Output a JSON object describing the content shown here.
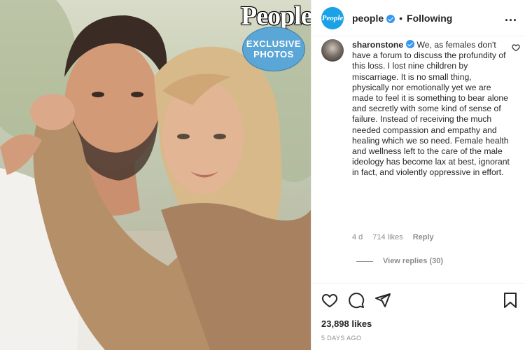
{
  "photo": {
    "badge_brand": "People",
    "badge_line1": "EXCLUSIVE",
    "badge_line2": "PHOTOS"
  },
  "header": {
    "avatar_text": "People",
    "username": "people",
    "separator": "•",
    "follow_status": "Following",
    "more_label": "..."
  },
  "comment": {
    "username": "sharonstone",
    "text": " We, as females don't have a forum to discuss the profundity of this loss. I lost nine children by miscarriage. It is no small thing, physically nor emotionally yet we are made to feel it is something to bear alone and secretly with some kind of sense of failure. Instead of receiving the much needed compassion and empathy and healing which we so need. Female health and wellness left to the care of the male ideology has become lax at best, ignorant in fact, and violently oppressive in effort.",
    "age": "4 d",
    "likes": "714 likes",
    "reply_label": "Reply",
    "view_replies": "View replies (30)"
  },
  "post": {
    "likes": "23,898 likes",
    "date": "5 DAYS AGO"
  },
  "icons": [
    "heart-icon",
    "comment-icon",
    "share-icon",
    "bookmark-icon",
    "verified-icon",
    "more-icon"
  ],
  "colors": {
    "verified_blue": "#3897f0",
    "people_blue": "#1aa1e6",
    "muted_text": "#8e8e8e"
  }
}
